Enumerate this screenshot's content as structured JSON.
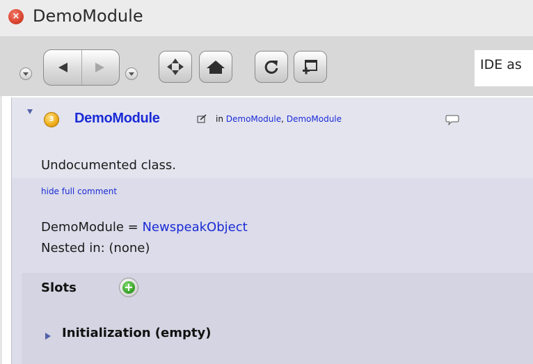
{
  "window": {
    "title": "DemoModule",
    "close_icon": "close-icon"
  },
  "toolbar": {
    "buttons": [
      "history-dropdown",
      "back",
      "forward",
      "forward-dropdown",
      "move",
      "home",
      "refresh",
      "new-window"
    ],
    "search_value": "IDE as"
  },
  "class_header": {
    "badge": "3",
    "name": "DemoModule",
    "in_label": "in",
    "container_links": [
      "DemoModule",
      "DemoModule"
    ],
    "separator": ","
  },
  "comment": {
    "text": "Undocumented class.",
    "toggle_link": "hide full comment"
  },
  "declaration": {
    "class_name": "DemoModule",
    "equals": " = ",
    "superclass": "NewspeakObject",
    "nested_label": "Nested in: (none)"
  },
  "slots": {
    "title": "Slots"
  },
  "initialization": {
    "label": "Initialization (empty)"
  },
  "colors": {
    "link": "#1a2bd6",
    "panel": "#dcdcea",
    "toolbar": "#d8d8d8"
  }
}
